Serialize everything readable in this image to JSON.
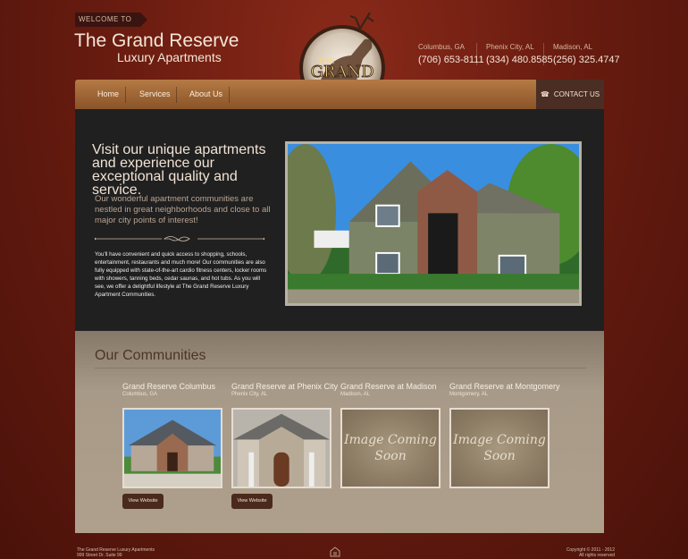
{
  "header": {
    "welcome": "WELCOME TO",
    "title": "The Grand Reserve",
    "subtitle": "Luxury Apartments",
    "logo_text": "THE GRAND RESERVE",
    "contacts": [
      {
        "city": "Columbus, GA",
        "phone": "(706) 653-8111"
      },
      {
        "city": "Phenix City, AL",
        "phone": "(334) 480.8585"
      },
      {
        "city": "Madison, AL",
        "phone": "(256) 325.4747"
      }
    ]
  },
  "nav": {
    "items": [
      "Home",
      "Services",
      "About Us"
    ],
    "contact_label": "CONTACT US"
  },
  "hero": {
    "headline": "Visit our unique apartments and experience our exceptional quality and service.",
    "intro": "Our wonderful apartment communities are nestled in great neighborhoods and close to all major city points of interest!",
    "body": "You'll have convenient and quick access to shopping, schools, entertainment, restaurants and much more! Our communities are also fully equipped with state-of-the-art cardio fitness centers, locker rooms with showers, tanning beds, cedar saunas, and hot tubs. As you will see, we offer a delightful lifestyle at The Grand Reserve Luxury Apartment Communities."
  },
  "communities": {
    "title": "Our Communities",
    "coming_soon": "Image Coming Soon",
    "button_label": "View Website",
    "cards": [
      {
        "name": "Grand Reserve Columbus",
        "city": "Columbus, GA"
      },
      {
        "name": "Grand Reserve at Phenix City",
        "city": "Phenix City, AL"
      },
      {
        "name": "Grand Reserve at Madison",
        "city": "Madison, AL"
      },
      {
        "name": "Grand Reserve at Montgomery",
        "city": "Montgomery, AL"
      }
    ]
  },
  "footer": {
    "left_line1": "The Grand Reserve Luxury Apartments",
    "left_line2": "999 Street Dr. Suite 99",
    "right_line1": "Copyright © 2011 - 2012",
    "right_line2": "All rights reserved"
  }
}
